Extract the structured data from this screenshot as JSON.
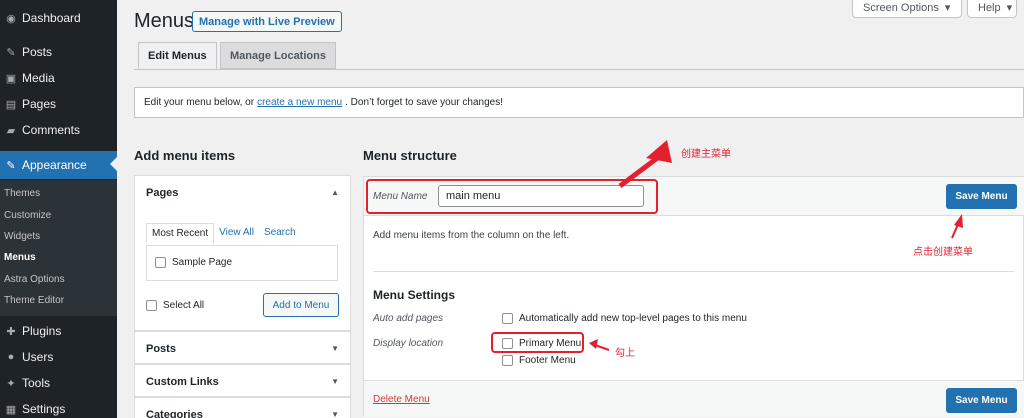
{
  "sidebar": {
    "items": [
      {
        "label": "Dashboard",
        "icon": "dashboard-icon",
        "glyph": "◉"
      },
      {
        "label": "Posts",
        "icon": "pin-icon",
        "glyph": "✎"
      },
      {
        "label": "Media",
        "icon": "media-icon",
        "glyph": "▣"
      },
      {
        "label": "Pages",
        "icon": "page-icon",
        "glyph": "▤"
      },
      {
        "label": "Comments",
        "icon": "comment-icon",
        "glyph": "▰"
      },
      {
        "label": "Appearance",
        "icon": "brush-icon",
        "glyph": "✎"
      },
      {
        "label": "Plugins",
        "icon": "plug-icon",
        "glyph": "✚"
      },
      {
        "label": "Users",
        "icon": "user-icon",
        "glyph": "●"
      },
      {
        "label": "Tools",
        "icon": "wrench-icon",
        "glyph": "✦"
      },
      {
        "label": "Settings",
        "icon": "settings-icon",
        "glyph": "▦"
      }
    ],
    "submenu": [
      "Themes",
      "Customize",
      "Widgets",
      "Menus",
      "Astra Options",
      "Theme Editor"
    ]
  },
  "screen_options": "Screen Options",
  "help": "Help",
  "page_title": "Menus",
  "preview_button": "Manage with Live Preview",
  "tabs": [
    "Edit Menus",
    "Manage Locations"
  ],
  "notice": {
    "before": "Edit your menu below, or",
    "link": "create a new menu",
    "after": ". Don’t forget to save your changes!"
  },
  "add_items": {
    "title": "Add menu items",
    "pages_title": "Pages",
    "inner_tabs": [
      "Most Recent",
      "View All",
      "Search"
    ],
    "page_item": "Sample Page",
    "select_all": "Select All",
    "add_button": "Add to Menu",
    "sections": [
      "Posts",
      "Custom Links",
      "Categories"
    ]
  },
  "structure": {
    "title": "Menu structure",
    "name_label": "Menu Name",
    "name_value": "main menu",
    "save_button": "Save Menu",
    "hint": "Add menu items from the column on the left.",
    "settings_title": "Menu Settings",
    "auto_add_label": "Auto add pages",
    "auto_add_option": "Automatically add new top-level pages to this menu",
    "display_label": "Display location",
    "locations": [
      "Primary Menu",
      "Footer Menu"
    ],
    "delete_link": "Delete Menu"
  },
  "annotations": {
    "create": "创建主菜单",
    "click": "点击创建菜单",
    "check": "勾上",
    "color": "#e3202e"
  },
  "colors": {
    "accent": "#2271b1",
    "sidebar": "#1d2327"
  }
}
